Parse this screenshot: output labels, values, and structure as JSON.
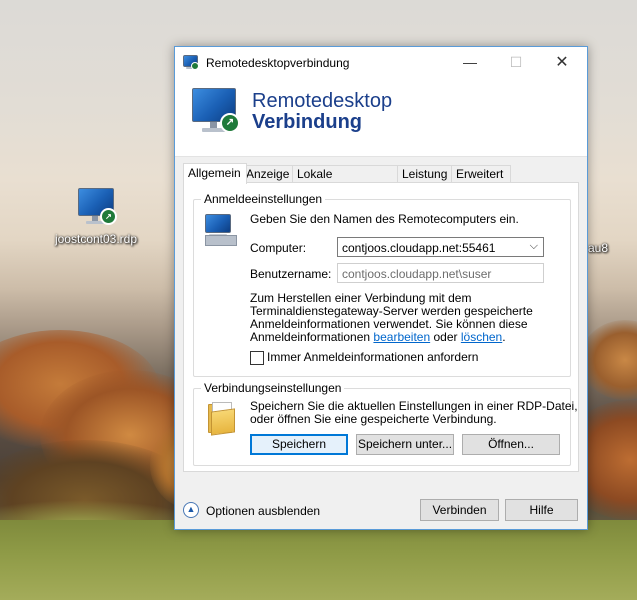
{
  "desktop": {
    "icon_left_label": "joostcont03.rdp",
    "icon_right_label_partial": "au8"
  },
  "window": {
    "title": "Remotedesktopverbindung",
    "controls": {
      "minimize": "—",
      "maximize": "☐",
      "close": "✕"
    }
  },
  "banner": {
    "line1": "Remotedesktop",
    "line2": "Verbindung"
  },
  "tabs": [
    "Allgemein",
    "Anzeige",
    "Lokale Ressourcen",
    "Leistung",
    "Erweitert"
  ],
  "logon": {
    "group_title": "Anmeldeeinstellungen",
    "intro": "Geben Sie den Namen des Remotecomputers ein.",
    "computer_label": "Computer:",
    "computer_value": "contjoos.cloudapp.net:55461",
    "username_label": "Benutzername:",
    "username_value": "contjoos.cloudapp.net\\suser",
    "info_line1": "Zum Herstellen einer Verbindung mit dem",
    "info_line2": "Terminaldienstegateway-Server werden gespeicherte",
    "info_line3": "Anmeldeinformationen verwendet. Sie können diese",
    "info_line4_a": "Anmeldeinformationen",
    "info_link_edit": "bearbeiten",
    "info_line4_b": "oder",
    "info_link_delete": "löschen",
    "info_line4_c": ".",
    "checkbox_label": "Immer Anmeldeinformationen anfordern",
    "checkbox_checked": false
  },
  "connection": {
    "group_title": "Verbindungseinstellungen",
    "text_line1": "Speichern Sie die aktuellen Einstellungen in einer RDP-Datei,",
    "text_line2": "oder öffnen Sie eine gespeicherte Verbindung.",
    "save_label": "Speichern",
    "save_as_label": "Speichern unter...",
    "open_label": "Öffnen..."
  },
  "footer": {
    "options_label": "Optionen ausblenden",
    "connect_label": "Verbinden",
    "help_label": "Hilfe"
  },
  "colors": {
    "banner_text": "#1b3f8b",
    "link": "#0066cc",
    "default_button_border": "#0078d7"
  }
}
